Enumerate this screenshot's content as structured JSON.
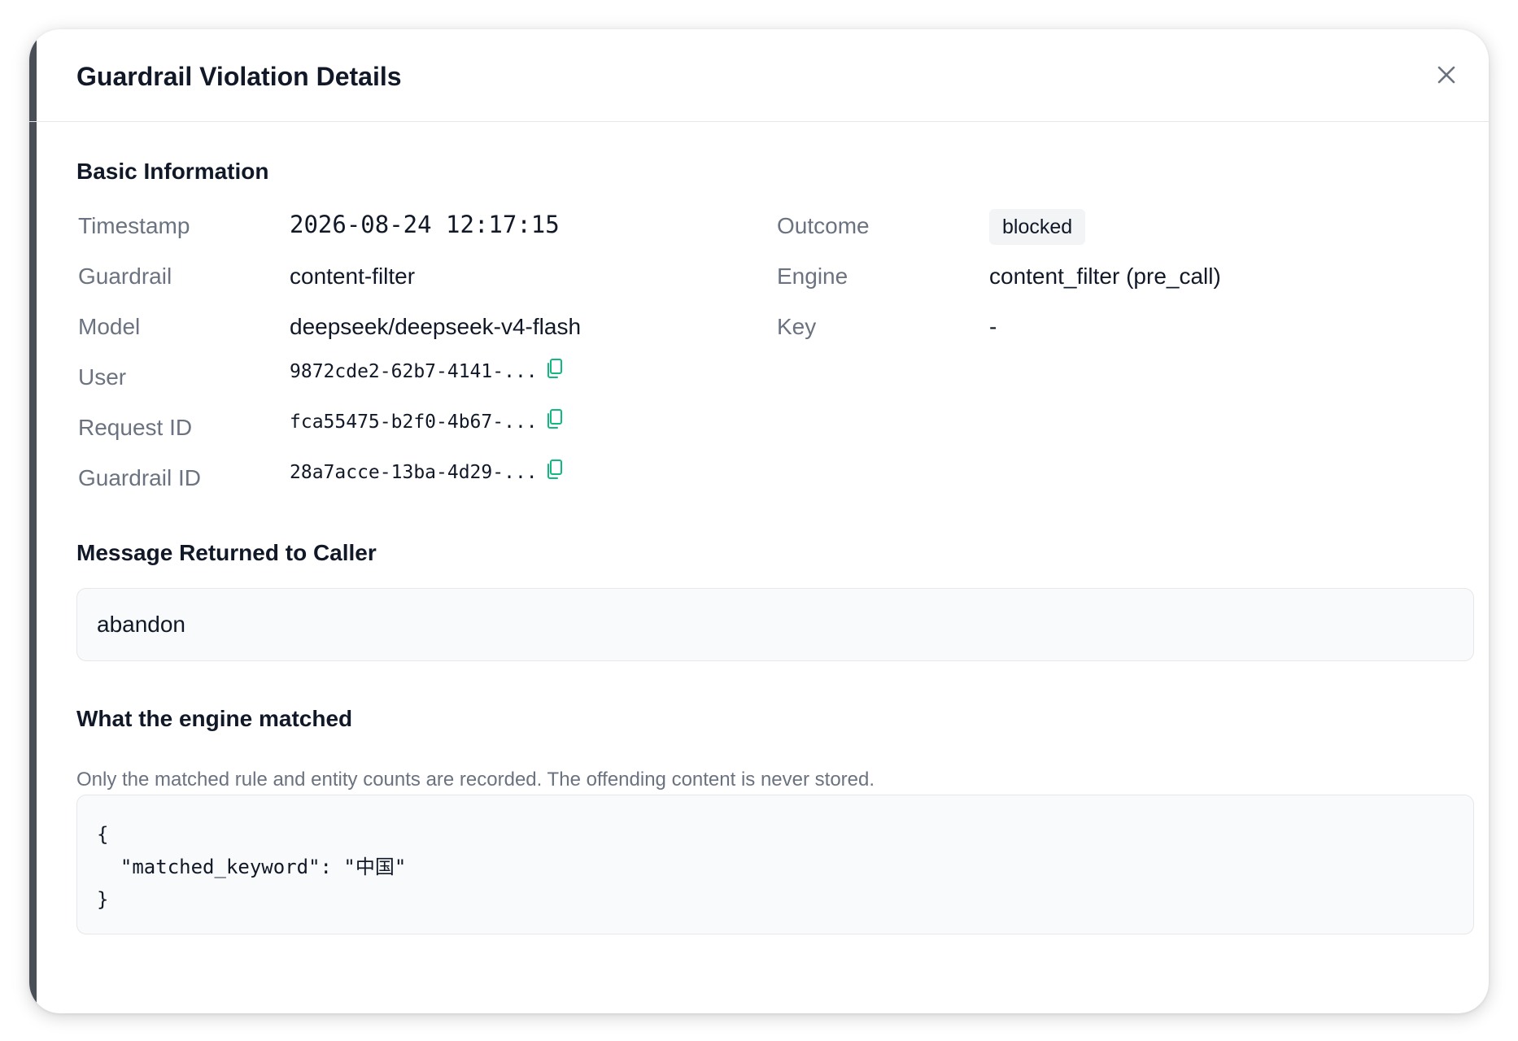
{
  "modal": {
    "title": "Guardrail Violation Details",
    "close_icon": "close-icon"
  },
  "basic_info": {
    "section_title": "Basic Information",
    "timestamp_label": "Timestamp",
    "timestamp_value": "2026-08-24 12:17:15",
    "guardrail_label": "Guardrail",
    "guardrail_value": "content-filter",
    "model_label": "Model",
    "model_value": "deepseek/deepseek-v4-flash",
    "user_label": "User",
    "user_value": "9872cde2-62b7-4141-...",
    "request_id_label": "Request ID",
    "request_id_value": "fca55475-b2f0-4b67-...",
    "guardrail_id_label": "Guardrail ID",
    "guardrail_id_value": "28a7acce-13ba-4d29-...",
    "outcome_label": "Outcome",
    "outcome_value": "blocked",
    "engine_label": "Engine",
    "engine_value": "content_filter (pre_call)",
    "key_label": "Key",
    "key_value": "-"
  },
  "message_returned": {
    "section_title": "Message Returned to Caller",
    "message": "abandon"
  },
  "engine_match": {
    "section_title": "What the engine matched",
    "hint": "Only the matched rule and entity counts are recorded. The offending content is never stored.",
    "code": "{\n  \"matched_keyword\": \"中国\"\n}"
  },
  "colors": {
    "copy_icon": "#10b981",
    "badge_bg": "#f3f4f6",
    "label_text": "#6b7280",
    "value_text": "#111827"
  }
}
